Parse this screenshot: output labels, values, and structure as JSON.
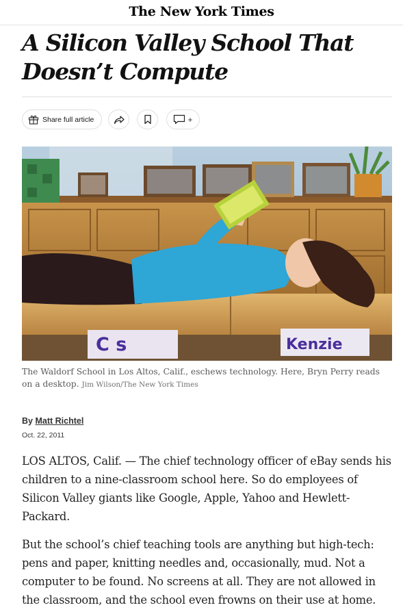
{
  "masthead": {
    "logo_text": "The New York Times"
  },
  "article": {
    "headline": "A Silicon Valley School That Doesn’t Compute",
    "toolbar": {
      "share_full_label": "Share full article",
      "share_icon": "share-arrow-icon",
      "save_icon": "bookmark-icon",
      "comments_icon": "comment-icon",
      "comments_plus": "+"
    },
    "photo": {
      "desk_label_left": "C s",
      "desk_label_right": "Kenzie"
    },
    "caption": "The Waldorf School in Los Altos, Calif., eschews technology. Here, Bryn Perry reads on a desktop.",
    "credit": "Jim Wilson/The New York Times",
    "byline_prefix": "By",
    "author": "Matt Richtel",
    "date": "Oct. 22, 2011",
    "paragraphs": [
      "LOS ALTOS, Calif. — The chief technology officer of eBay sends his children to a nine-classroom school here. So do employees of Silicon Valley giants like Google, Apple, Yahoo and Hewlett-Packard.",
      "But the school’s chief teaching tools are anything but high-tech: pens and paper, knitting needles and, occasionally, mud. Not a computer to be found. No screens at all. They are not allowed in the classroom, and the school even frowns on their use at home."
    ]
  }
}
